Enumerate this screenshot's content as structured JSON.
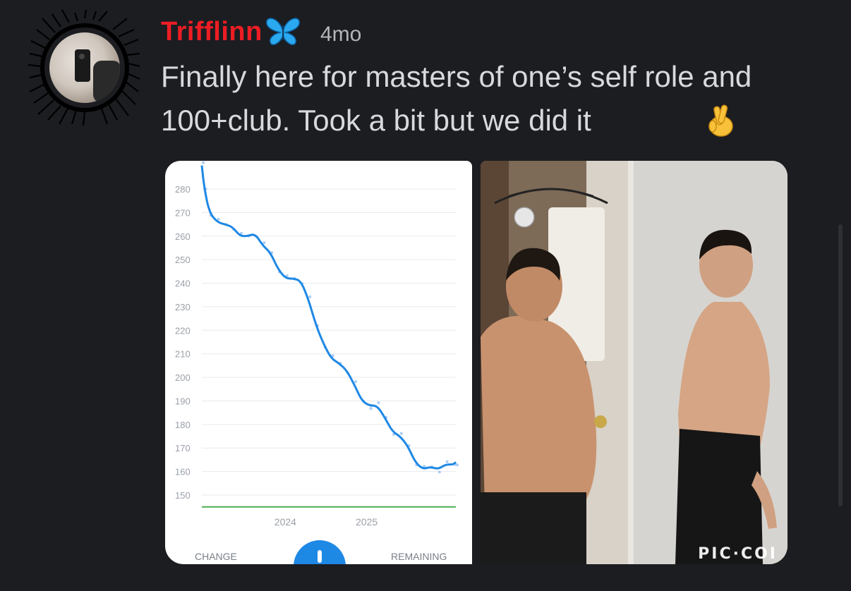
{
  "post": {
    "author": "Trifflinn",
    "author_color": "#ed1d24",
    "author_badge_icon": "butterfly-icon",
    "timestamp": "4mo",
    "message": "Finally here for masters of one’s self role and 100+club. Took a bit but we did it",
    "message_emoji": "crossed-fingers-icon"
  },
  "attachments": {
    "chart": {
      "change_label": "CHANGE",
      "remaining_label": "REMAINING",
      "fab_icon": "add-icon",
      "fab_color": "#1e88e5"
    },
    "photo": {
      "watermark": "PIC·COI"
    }
  },
  "chart_data": {
    "type": "line",
    "title": "",
    "xlabel": "",
    "ylabel": "",
    "x_tick_labels": [
      "2024",
      "2025"
    ],
    "y_ticks": [
      280,
      270,
      260,
      250,
      240,
      230,
      220,
      210,
      200,
      190,
      180,
      170,
      160,
      150
    ],
    "ylim": [
      145,
      290
    ],
    "goal_line": 145,
    "goal_color": "#4caf50",
    "line_color": "#1e88e5",
    "grid": true,
    "series": [
      {
        "x": [
          0.0,
          0.01,
          0.03,
          0.06,
          0.09,
          0.12,
          0.15,
          0.18,
          0.21,
          0.24,
          0.27,
          0.3,
          0.33,
          0.36,
          0.39,
          0.42,
          0.45,
          0.48,
          0.51,
          0.54,
          0.57,
          0.6,
          0.63,
          0.66,
          0.69,
          0.72,
          0.75,
          0.78,
          0.81,
          0.84,
          0.87,
          0.9,
          0.93,
          0.96,
          0.99,
          1.0
        ],
        "values": [
          290,
          280,
          270,
          266,
          265,
          264,
          260,
          260,
          261,
          256,
          253,
          246,
          242,
          242,
          241,
          233,
          222,
          214,
          208,
          206,
          203,
          197,
          190,
          188,
          188,
          183,
          177,
          175,
          171,
          164,
          161,
          162,
          161,
          163,
          163,
          164
        ]
      }
    ]
  }
}
